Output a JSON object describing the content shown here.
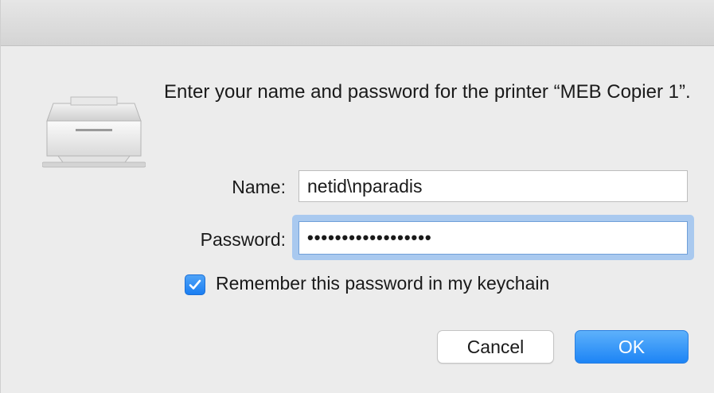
{
  "dialog": {
    "message": "Enter your name and password for the printer “MEB Copier 1”.",
    "icon": "printer-icon"
  },
  "form": {
    "name_label": "Name:",
    "name_value": "netid\\nparadis",
    "password_label": "Password:",
    "password_masked": "••••••••••••••••••",
    "remember_label": "Remember this password in my keychain",
    "remember_checked": true
  },
  "buttons": {
    "cancel_label": "Cancel",
    "ok_label": "OK"
  },
  "colors": {
    "accent": "#1d84f5",
    "focus_ring": "#a9c9ef"
  }
}
